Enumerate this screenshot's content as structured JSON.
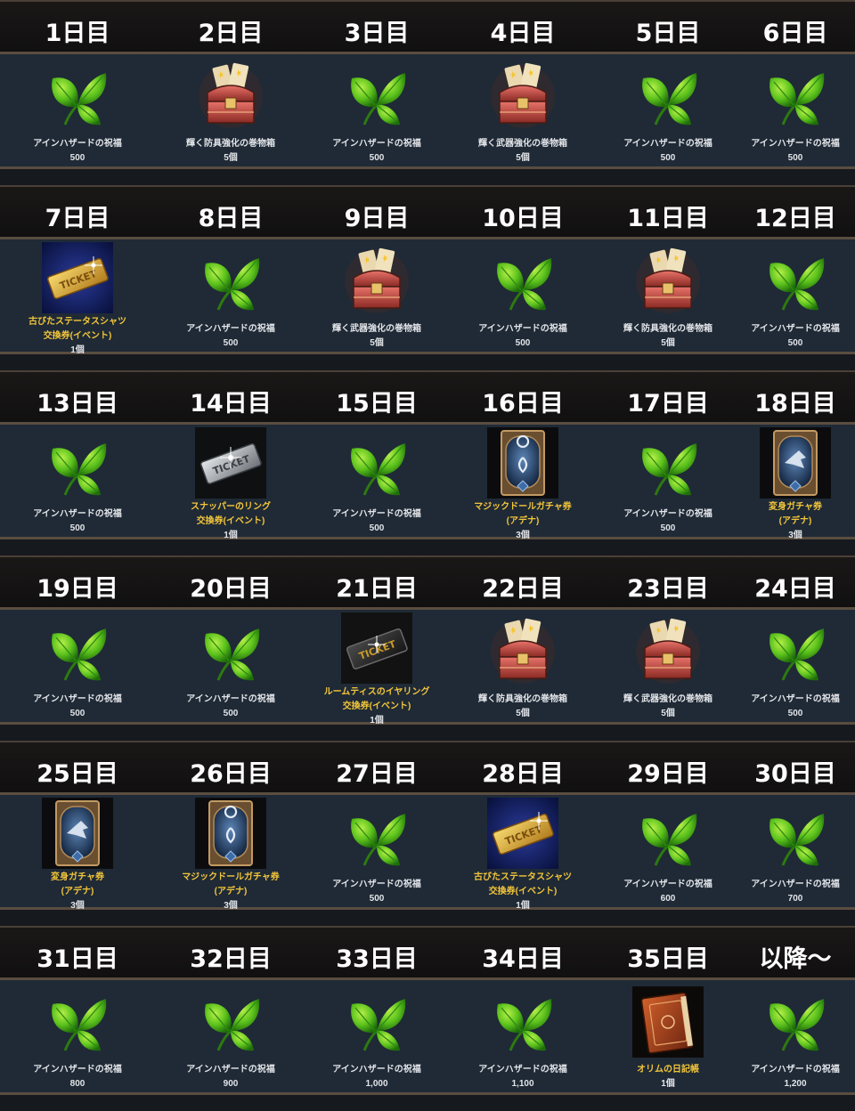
{
  "rows": [
    {
      "cells": [
        {
          "day": "1日目",
          "icon": "leaf-icon",
          "name": [
            "アインハザードの祝福"
          ],
          "qty": "500",
          "gold": false
        },
        {
          "day": "2日目",
          "icon": "chest-icon",
          "name": [
            "輝く防具強化の巻物箱"
          ],
          "qty": "5個",
          "gold": false
        },
        {
          "day": "3日目",
          "icon": "leaf-icon",
          "name": [
            "アインハザードの祝福"
          ],
          "qty": "500",
          "gold": false
        },
        {
          "day": "4日目",
          "icon": "chest-icon",
          "name": [
            "輝く武器強化の巻物箱"
          ],
          "qty": "5個",
          "gold": false
        },
        {
          "day": "5日目",
          "icon": "leaf-icon",
          "name": [
            "アインハザードの祝福"
          ],
          "qty": "500",
          "gold": false
        },
        {
          "day": "6日目",
          "icon": "leaf-icon",
          "name": [
            "アインハザードの祝福"
          ],
          "qty": "500",
          "gold": false
        }
      ]
    },
    {
      "cells": [
        {
          "day": "7日目",
          "icon": "gold-ticket-icon",
          "name": [
            "古びたステータスシャツ",
            "交換券(イベント)"
          ],
          "qty": "1個",
          "gold": true
        },
        {
          "day": "8日目",
          "icon": "leaf-icon",
          "name": [
            "アインハザードの祝福"
          ],
          "qty": "500",
          "gold": false
        },
        {
          "day": "9日目",
          "icon": "chest-icon",
          "name": [
            "輝く武器強化の巻物箱"
          ],
          "qty": "5個",
          "gold": false
        },
        {
          "day": "10日目",
          "icon": "leaf-icon",
          "name": [
            "アインハザードの祝福"
          ],
          "qty": "500",
          "gold": false
        },
        {
          "day": "11日目",
          "icon": "chest-icon",
          "name": [
            "輝く防具強化の巻物箱"
          ],
          "qty": "5個",
          "gold": false
        },
        {
          "day": "12日目",
          "icon": "leaf-icon",
          "name": [
            "アインハザードの祝福"
          ],
          "qty": "500",
          "gold": false
        }
      ]
    },
    {
      "cells": [
        {
          "day": "13日目",
          "icon": "leaf-icon",
          "name": [
            "アインハザードの祝福"
          ],
          "qty": "500",
          "gold": false
        },
        {
          "day": "14日目",
          "icon": "silver-ticket-icon",
          "name": [
            "スナッパーのリング",
            "交換券(イベント)"
          ],
          "qty": "1個",
          "gold": true
        },
        {
          "day": "15日目",
          "icon": "leaf-icon",
          "name": [
            "アインハザードの祝福"
          ],
          "qty": "500",
          "gold": false
        },
        {
          "day": "16日目",
          "icon": "doll-card-icon",
          "name": [
            "マジックドールガチャ券",
            "(アデナ)"
          ],
          "qty": "3個",
          "gold": true
        },
        {
          "day": "17日目",
          "icon": "leaf-icon",
          "name": [
            "アインハザードの祝福"
          ],
          "qty": "500",
          "gold": false
        },
        {
          "day": "18日目",
          "icon": "transform-card-icon",
          "name": [
            "変身ガチャ券",
            "(アデナ)"
          ],
          "qty": "3個",
          "gold": true
        }
      ]
    },
    {
      "cells": [
        {
          "day": "19日目",
          "icon": "leaf-icon",
          "name": [
            "アインハザードの祝福"
          ],
          "qty": "500",
          "gold": false
        },
        {
          "day": "20日目",
          "icon": "leaf-icon",
          "name": [
            "アインハザードの祝福"
          ],
          "qty": "500",
          "gold": false
        },
        {
          "day": "21日目",
          "icon": "black-ticket-icon",
          "name": [
            "ルームティスのイヤリング",
            "交換券(イベント)"
          ],
          "qty": "1個",
          "gold": true
        },
        {
          "day": "22日目",
          "icon": "chest-icon",
          "name": [
            "輝く防具強化の巻物箱"
          ],
          "qty": "5個",
          "gold": false
        },
        {
          "day": "23日目",
          "icon": "chest-icon",
          "name": [
            "輝く武器強化の巻物箱"
          ],
          "qty": "5個",
          "gold": false
        },
        {
          "day": "24日目",
          "icon": "leaf-icon",
          "name": [
            "アインハザードの祝福"
          ],
          "qty": "500",
          "gold": false
        }
      ]
    },
    {
      "cells": [
        {
          "day": "25日目",
          "icon": "transform-card-icon",
          "name": [
            "変身ガチャ券",
            "(アデナ)"
          ],
          "qty": "3個",
          "gold": true
        },
        {
          "day": "26日目",
          "icon": "doll-card-icon",
          "name": [
            "マジックドールガチャ券",
            "(アデナ)"
          ],
          "qty": "3個",
          "gold": true
        },
        {
          "day": "27日目",
          "icon": "leaf-icon",
          "name": [
            "アインハザードの祝福"
          ],
          "qty": "500",
          "gold": false
        },
        {
          "day": "28日目",
          "icon": "gold-ticket-icon",
          "name": [
            "古びたステータスシャツ",
            "交換券(イベント)"
          ],
          "qty": "1個",
          "gold": true
        },
        {
          "day": "29日目",
          "icon": "leaf-icon",
          "name": [
            "アインハザードの祝福"
          ],
          "qty": "600",
          "gold": false
        },
        {
          "day": "30日目",
          "icon": "leaf-icon",
          "name": [
            "アインハザードの祝福"
          ],
          "qty": "700",
          "gold": false
        }
      ]
    },
    {
      "cells": [
        {
          "day": "31日目",
          "icon": "leaf-icon",
          "name": [
            "アインハザードの祝福"
          ],
          "qty": "800",
          "gold": false
        },
        {
          "day": "32日目",
          "icon": "leaf-icon",
          "name": [
            "アインハザードの祝福"
          ],
          "qty": "900",
          "gold": false
        },
        {
          "day": "33日目",
          "icon": "leaf-icon",
          "name": [
            "アインハザードの祝福"
          ],
          "qty": "1,000",
          "gold": false
        },
        {
          "day": "34日目",
          "icon": "leaf-icon",
          "name": [
            "アインハザードの祝福"
          ],
          "qty": "1,100",
          "gold": false
        },
        {
          "day": "35日目",
          "icon": "diary-book-icon",
          "name": [
            "オリムの日記帳"
          ],
          "qty": "1個",
          "gold": true
        },
        {
          "day": "以降～",
          "icon": "leaf-icon",
          "name": [
            "アインハザードの祝福"
          ],
          "qty": "1,200",
          "gold": false
        }
      ]
    }
  ]
}
